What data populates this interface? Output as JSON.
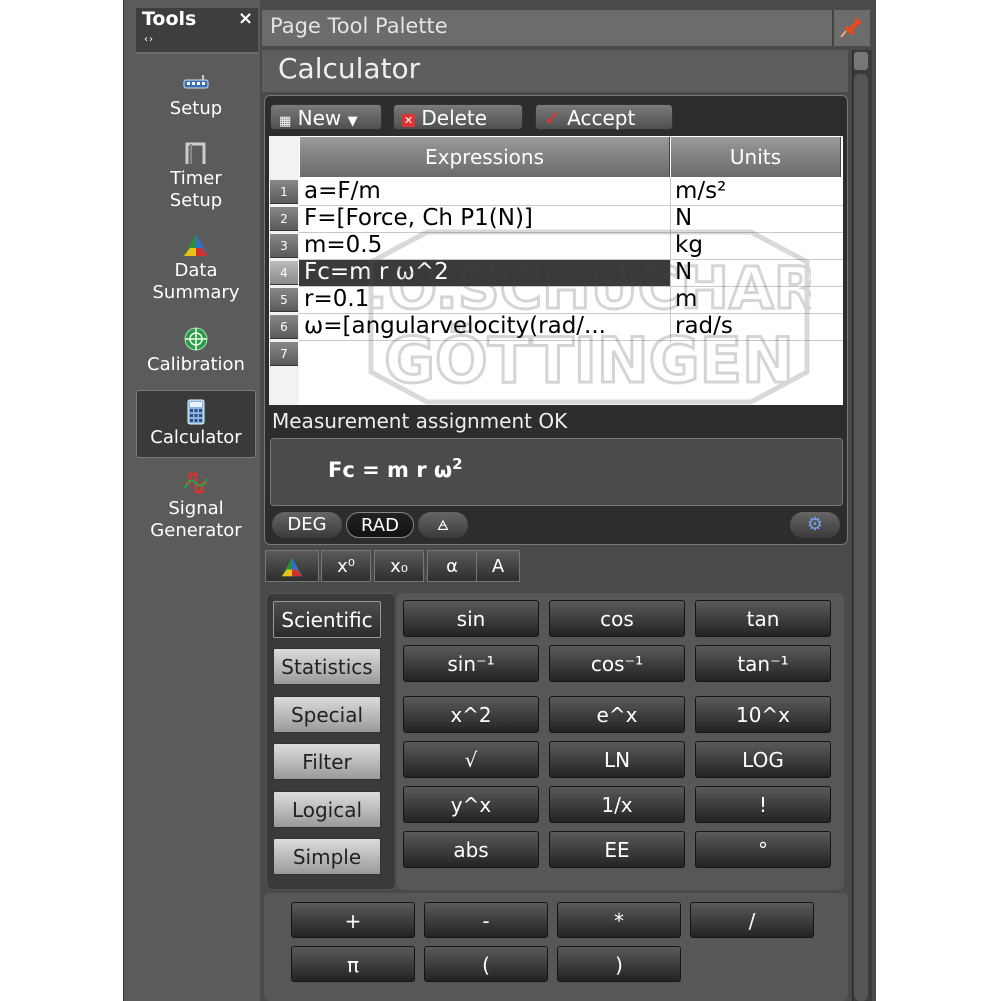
{
  "sidebar": {
    "title": "Tools",
    "close": "×",
    "grip": "‹›",
    "items": [
      {
        "label": "Setup",
        "icon": "setup-icon"
      },
      {
        "label": "Timer Setup",
        "line1": "Timer",
        "line2": "Setup",
        "icon": "timer-icon"
      },
      {
        "label": "Data Summary",
        "line1": "Data",
        "line2": "Summary",
        "icon": "data-summary-icon"
      },
      {
        "label": "Calibration",
        "icon": "calibration-icon"
      },
      {
        "label": "Calculator",
        "icon": "calculator-icon",
        "selected": true
      },
      {
        "label": "Signal Generator",
        "line1": "Signal",
        "line2": "Generator",
        "icon": "signal-generator-icon"
      }
    ]
  },
  "palette": {
    "title": "Page Tool Palette",
    "pin_icon": "pin-icon",
    "section": "Calculator"
  },
  "toolbar": {
    "new_label": "New",
    "delete_label": "Delete",
    "accept_label": "Accept"
  },
  "table": {
    "headers": {
      "expressions": "Expressions",
      "units": "Units"
    },
    "rows": [
      {
        "num": "1",
        "expr": "a=F/m",
        "unit": "m/s²"
      },
      {
        "num": "2",
        "expr": "F=[Force, Ch P1(N)]",
        "unit": "N"
      },
      {
        "num": "3",
        "expr": "m=0.5",
        "unit": "kg"
      },
      {
        "num": "4",
        "expr": "Fc=m r ω^2",
        "unit": "N"
      },
      {
        "num": "5",
        "expr": "r=0.1",
        "unit": "m"
      },
      {
        "num": "6",
        "expr": "ω=[angularvelocity(rad/...",
        "unit": "rad/s"
      },
      {
        "num": "7",
        "expr": "",
        "unit": ""
      }
    ]
  },
  "status": "Measurement assignment OK",
  "formula": {
    "text": "Fc = m r ω",
    "sup": "2"
  },
  "angle_modes": {
    "deg": "DEG",
    "rad": "RAD"
  },
  "insert_buttons": [
    "x⁰",
    "x₀",
    "α",
    "A"
  ],
  "categories": [
    "Scientific",
    "Statistics",
    "Special",
    "Filter",
    "Logical",
    "Simple"
  ],
  "functions": [
    [
      "sin",
      "cos",
      "tan"
    ],
    [
      "sin⁻¹",
      "cos⁻¹",
      "tan⁻¹"
    ],
    [
      "x^2",
      "e^x",
      "10^x"
    ],
    [
      "√",
      "LN",
      "LOG"
    ],
    [
      "y^x",
      "1/x",
      "!"
    ],
    [
      "abs",
      "EE",
      "°"
    ]
  ],
  "operators": [
    [
      "+",
      "-",
      "*",
      "/"
    ],
    [
      "π",
      "(",
      ")"
    ]
  ],
  "watermark": {
    "line1": "DR.O.SCHUCHARDT",
    "line2": "GÖTTINGEN"
  }
}
